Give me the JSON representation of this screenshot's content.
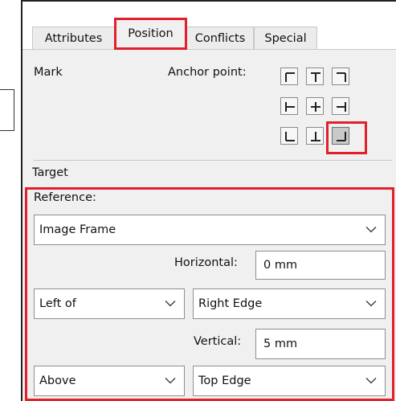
{
  "tabs": [
    {
      "label": "Attributes",
      "active": false
    },
    {
      "label": "Position",
      "active": true
    },
    {
      "label": "Conflicts",
      "active": false
    },
    {
      "label": "Special",
      "active": false
    }
  ],
  "mark": {
    "label": "Mark",
    "anchor_label": "Anchor point:",
    "anchor_grid": [
      "top-left",
      "top-center",
      "top-right",
      "middle-left",
      "center",
      "middle-right",
      "bottom-left",
      "bottom-center",
      "bottom-right"
    ],
    "selected_anchor": "bottom-right"
  },
  "target": {
    "label": "Target",
    "reference_label": "Reference:",
    "reference_value": "Image Frame",
    "horizontal_label": "Horizontal:",
    "horizontal_value": "0 mm",
    "horizontal_relation": "Left of",
    "horizontal_edge": "Right Edge",
    "vertical_label": "Vertical:",
    "vertical_value": "5 mm",
    "vertical_relation": "Above",
    "vertical_edge": "Top Edge"
  },
  "colors": {
    "highlight": "#e0202a",
    "panel_bg": "#f0f0f0"
  }
}
